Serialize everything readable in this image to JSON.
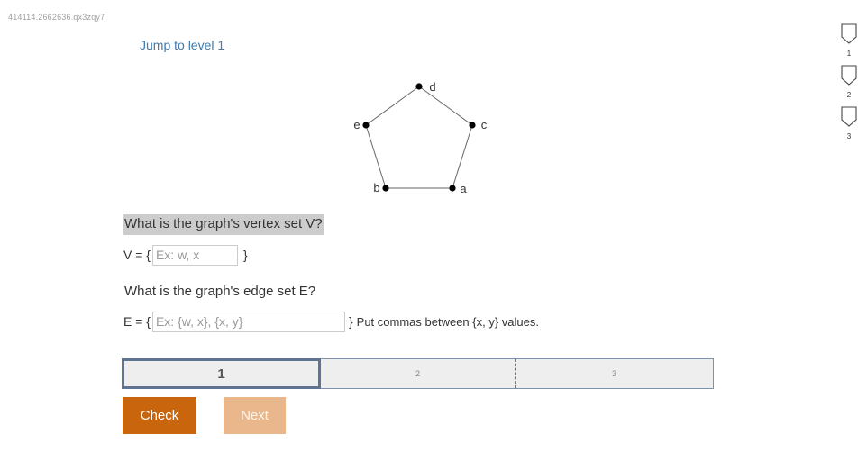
{
  "header": {
    "activity_id": "414114.2662636.qx3zqy7",
    "jump_link": "Jump to level 1"
  },
  "graph": {
    "vertices": [
      {
        "label": "d"
      },
      {
        "label": "c"
      },
      {
        "label": "e"
      },
      {
        "label": "b"
      },
      {
        "label": "a"
      }
    ],
    "edges": [
      [
        "d",
        "c"
      ],
      [
        "c",
        "a"
      ],
      [
        "a",
        "b"
      ],
      [
        "b",
        "e"
      ],
      [
        "e",
        "d"
      ]
    ]
  },
  "question_vertices": {
    "prompt": "What is the graph's vertex set V?",
    "prefix": "V = {",
    "placeholder": "Ex: w, x",
    "suffix": "}"
  },
  "question_edges": {
    "prompt": "What is the graph's edge set E?",
    "prefix": "E = {",
    "placeholder": "Ex: {w, x}, {x, y}",
    "suffix": "}",
    "hint": "Put commas between {x, y} values."
  },
  "progress": {
    "segments": [
      "1",
      "2",
      "3"
    ],
    "current": 1
  },
  "buttons": {
    "check": "Check",
    "next": "Next"
  },
  "level_nav": {
    "levels": [
      "1",
      "2",
      "3"
    ]
  },
  "colors": {
    "link": "#3d7bb0",
    "check_button": "#c9650d",
    "next_button_disabled": "#e9b78b",
    "highlight": "#cccccc",
    "progress_border": "#5f7491"
  }
}
